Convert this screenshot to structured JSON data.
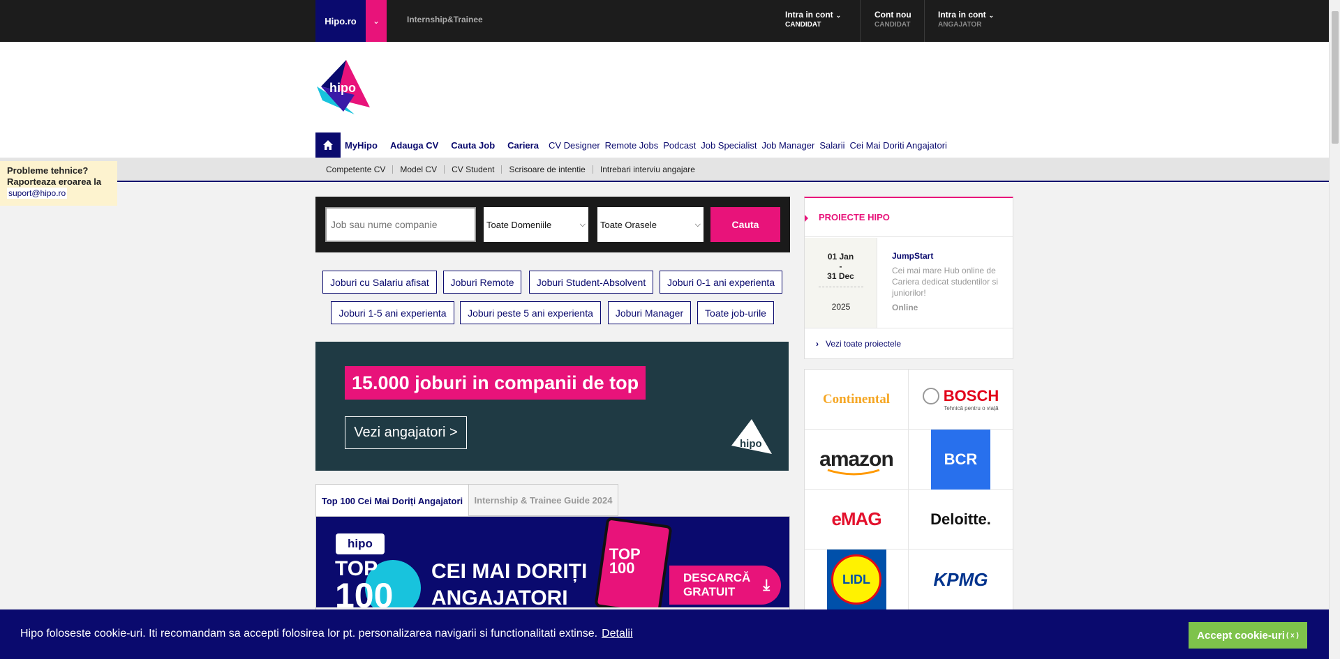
{
  "topbar": {
    "brand": "Hipo.ro",
    "dropdown_icon": "chevron-down-icon",
    "internship": "Internship&Trainee",
    "accounts": [
      {
        "line1": "Intra in cont",
        "line2": "CANDIDAT"
      },
      {
        "line1": "Cont nou",
        "line2": "CANDIDAT"
      },
      {
        "line1": "Intra in cont",
        "line2": "ANGAJATOR"
      }
    ]
  },
  "header": {
    "logo_text": "hipo",
    "nav": [
      "MyHipo",
      "Adauga CV",
      "Cauta Job",
      "Cariera",
      "CV Designer",
      "Remote Jobs",
      "Podcast",
      "Job Specialist",
      "Job Manager",
      "Salarii",
      "Cei Mai Doriti Angajatori"
    ],
    "subnav": [
      "Competente CV",
      "Model CV",
      "CV Student",
      "Scrisoare de intentie",
      "Intrebari interviu angajare"
    ]
  },
  "support": {
    "line1": "Probleme tehnice?",
    "line2": "Raporteaza eroarea la",
    "email": "suport@hipo.ro"
  },
  "search": {
    "placeholder": "Job sau nume companie",
    "domain_select": "Toate Domeniile",
    "city_select": "Toate Orasele",
    "button": "Cauta"
  },
  "tags": [
    "Joburi cu Salariu afisat",
    "Joburi Remote",
    "Joburi Student-Absolvent",
    "Joburi 0-1 ani experienta",
    "Joburi 1-5 ani experienta",
    "Joburi peste 5 ani experienta",
    "Joburi Manager",
    "Toate job-urile"
  ],
  "banner": {
    "title": "15.000 joburi in companii de top",
    "button": "Vezi angajatori >",
    "logo_text": "hipo"
  },
  "tabs": {
    "tab1": "Top 100 Cei Mai Doriți Angajatori",
    "tab2": "Internship & Trainee Guide 2024"
  },
  "top100": {
    "logo": "hipo",
    "top": "TOP",
    "num": "100",
    "title1": "CEI MAI DORIȚI",
    "title2": "ANGAJATORI",
    "tablet_top": "TOP",
    "tablet_num": "100",
    "download1": "DESCARCĂ",
    "download2": "GRATUIT",
    "download_icon": "download-icon"
  },
  "projects": {
    "title": "PROIECTE HIPO",
    "item": {
      "date_start": "01 Jan",
      "date_sep": "-",
      "date_end": "31 Dec",
      "year": "2025",
      "name": "JumpStart",
      "description": "Cei mai mare Hub online de Cariera dedicat studentilor si juniorilor!",
      "mode": "Online"
    },
    "see_all": "Vezi toate proiectele"
  },
  "companies": [
    {
      "name": "Continental",
      "color": "#f5a623"
    },
    {
      "name": "BOSCH",
      "sub": "Tehnică pentru o viață",
      "color": "#e2001a"
    },
    {
      "name": "amazon",
      "color": "#222222"
    },
    {
      "name": "BCR",
      "color": "#ffffff",
      "bg": "#2870ed"
    },
    {
      "name": "eMAG",
      "color": "#e3112d"
    },
    {
      "name": "Deloitte.",
      "color": "#111111"
    },
    {
      "name": "LIDL",
      "color": "#0050aa"
    },
    {
      "name": "KPMG",
      "color": "#00338d"
    }
  ],
  "cookie": {
    "text": "Hipo foloseste cookie-uri. Iti recomandam sa accepti folosirea lor pt. personalizarea navigarii si functionalitati extinse.",
    "link": "Detalii",
    "button": "Accept cookie-uri",
    "button_close": "( x )"
  },
  "colors": {
    "navy": "#0a0a6e",
    "pink": "#e8137a",
    "green": "#7ec34b"
  }
}
